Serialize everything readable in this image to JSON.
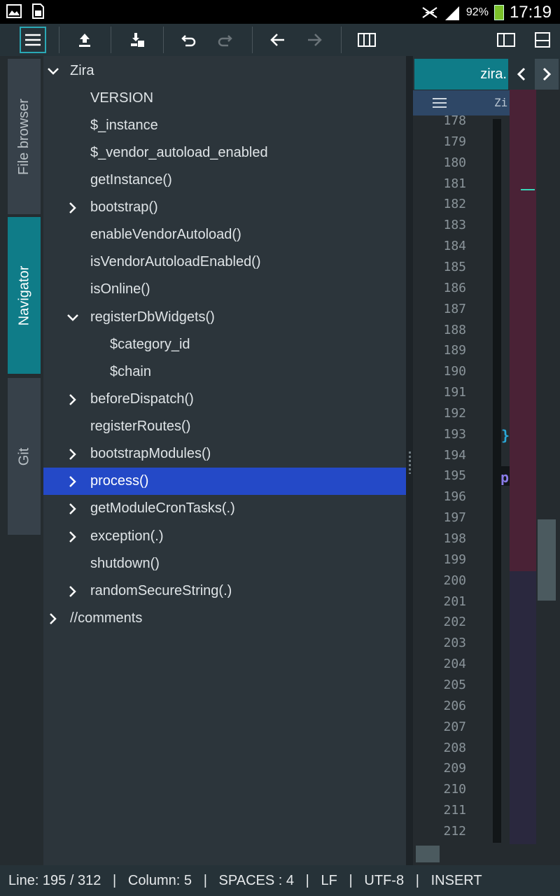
{
  "status_bar": {
    "battery": "92%",
    "time": "17:19",
    "icons": [
      "gallery-icon",
      "sim-icon",
      "silent-icon",
      "signal-icon",
      "battery-icon"
    ]
  },
  "toolbar": {
    "buttons": [
      "menu-icon",
      "upload-icon",
      "save-as-icon",
      "undo-icon",
      "redo-icon",
      "back-icon",
      "forward-icon",
      "columns-icon",
      "sidebar-toggle-icon",
      "split-view-icon"
    ]
  },
  "side_tabs": {
    "file_browser": "File browser",
    "navigator": "Navigator",
    "git": "Git"
  },
  "navigator": {
    "root": "Zira",
    "items": [
      "VERSION",
      "$_instance",
      "$_vendor_autoload_enabled",
      "getInstance()",
      "bootstrap()",
      "enableVendorAutoload()",
      "isVendorAutoloadEnabled()",
      "isOnline()",
      "registerDbWidgets()",
      "$category_id",
      "$chain",
      "beforeDispatch()",
      "registerRoutes()",
      "bootstrapModules()",
      "process()",
      "getModuleCronTasks(.)",
      "exception(.)",
      "shutdown()",
      "randomSecureString(.)"
    ],
    "comments": "//comments"
  },
  "editor": {
    "tab_label": "zira.",
    "breadcrumb": "Zi",
    "line_numbers": [
      "178",
      "179",
      "180",
      "181",
      "182",
      "183",
      "184",
      "185",
      "186",
      "187",
      "188",
      "189",
      "190",
      "191",
      "192",
      "193",
      "194",
      "195",
      "196",
      "197",
      "198",
      "199",
      "200",
      "201",
      "202",
      "203",
      "204",
      "205",
      "206",
      "207",
      "208",
      "209",
      "210",
      "211",
      "212"
    ],
    "brace": "}",
    "p_char": "p"
  },
  "footer": {
    "text": "Line: 195 / 312   |   Column: 5   |   SPACES : 4   |   LF   |   UTF-8   |   INSERT"
  },
  "colors": {
    "accent": "#0f7c88",
    "selection": "#2449c7"
  }
}
